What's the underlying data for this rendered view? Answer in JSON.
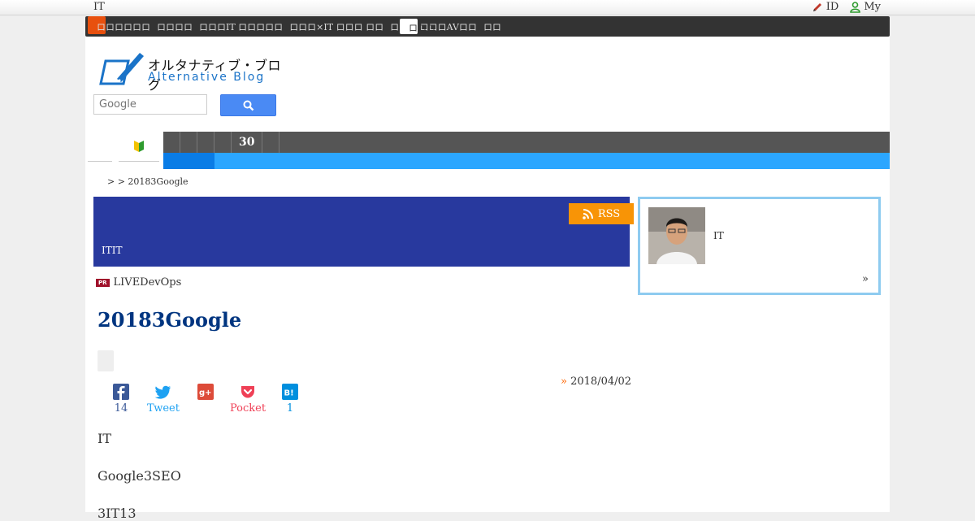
{
  "topbar": {
    "site_name": "IT",
    "id_label": "ID",
    "my_label": "My"
  },
  "netbar": {
    "items": [
      "ロロロロロロ",
      "ロロロロ",
      "ロロロIT ロロロロロ",
      "ロロロ×IT ロロロ ロロ",
      "ロロロ ロロロAVロロ",
      "ロロ"
    ],
    "last_label": "ロロロ"
  },
  "logo": {
    "jp": "オルタナティブ・ブログ",
    "en": "Alternative Blog"
  },
  "search": {
    "placeholder": "Google"
  },
  "category_bar": {
    "number": "30"
  },
  "breadcrumb": {
    "text": "> > 20183Google"
  },
  "blog_header": {
    "description": "ITIT",
    "rss_label": "RSS"
  },
  "pr": {
    "badge": "PR",
    "text": "LIVEDevOps"
  },
  "article": {
    "title": "20183Google",
    "date": "2018/04/02",
    "date_marker": "»",
    "paragraphs": [
      "IT",
      "Google3SEO",
      "3IT13"
    ]
  },
  "social": {
    "facebook_count": "14",
    "tweet_label": "Tweet",
    "pocket_label": "Pocket",
    "hatena_count": "1"
  },
  "sidebar": {
    "author_name": "IT",
    "more": "»"
  },
  "colors": {
    "header_blue": "#28399e",
    "rss_orange": "#f89406",
    "nav_blue": "#2ba6ff",
    "title_blue": "#003580",
    "sidebar_border": "#8ecbf0"
  }
}
